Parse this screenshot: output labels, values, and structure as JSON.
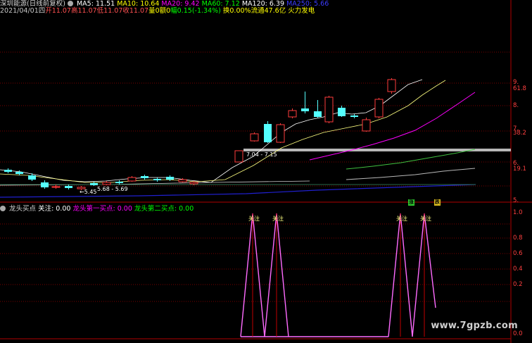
{
  "header": {
    "stock": "深圳能源(日线前复权)",
    "ma5": "MA5: 11.51",
    "ma10": "MA10: 10.64",
    "ma20": "MA20: 9.42",
    "ma60": "MA60: 7.12",
    "ma120": "MA120: 6.39",
    "ma250": "MA250: 5.66"
  },
  "info": {
    "date": "2021/04/01四",
    "open": "开11.07",
    "high": "高11.07",
    "low": "低11.07",
    "close": "收11.07",
    "volume": "量0",
    "amount": "额0",
    "change": "幅0.15(-1.34%)",
    "turnover": "换0.00%",
    "float": "流通47.6亿",
    "sector": "火力发电"
  },
  "indicator": {
    "name": "龙头买点",
    "guanzhu": "关注: 0.00",
    "buy1": "龙头第一买点: 0.00",
    "buy2": "龙头第二买点: 0.00",
    "signal_label": "关注"
  },
  "annotations": {
    "low1": "5.45",
    "low2": "5.68 - 5.69",
    "range": "7.04 - 7.15",
    "badge1": "涨",
    "badge2": "跌"
  },
  "axis_main": [
    "9.",
    "61.8",
    "8.",
    "7.",
    "38.2",
    "6.",
    "19.1",
    "5."
  ],
  "axis_ind": [
    "1.0",
    "0.8",
    "0.6",
    "0.4",
    "0.2",
    "0.0"
  ],
  "watermark": "www.7gpzb.com",
  "colors": {
    "up": "#ff3c3c",
    "down": "#54ffff",
    "ma5": "#ffffff",
    "ma10": "#ffff00",
    "ma20": "#ff00ff",
    "ma60": "#00ff00",
    "ma120": "#ffffff",
    "ma250": "#3b3bff",
    "signal": "#ff6bff"
  }
}
